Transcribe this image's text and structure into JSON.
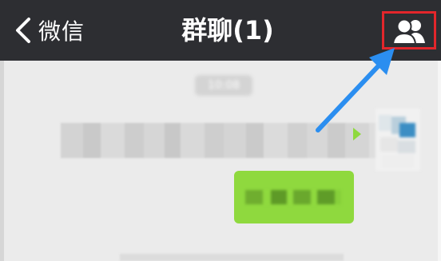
{
  "header": {
    "back_label": "微信",
    "title": "群聊(1)",
    "back_icon": "chevron-left-icon",
    "members_icon": "group-members-icon",
    "background": "#2d2e32",
    "highlight_color": "#e3262b"
  },
  "annotation": {
    "arrow_color": "#2b8ef0"
  },
  "chat": {
    "timestamp": "10:08",
    "bubble_color": "#8fd93e",
    "background": "#ebebeb"
  }
}
